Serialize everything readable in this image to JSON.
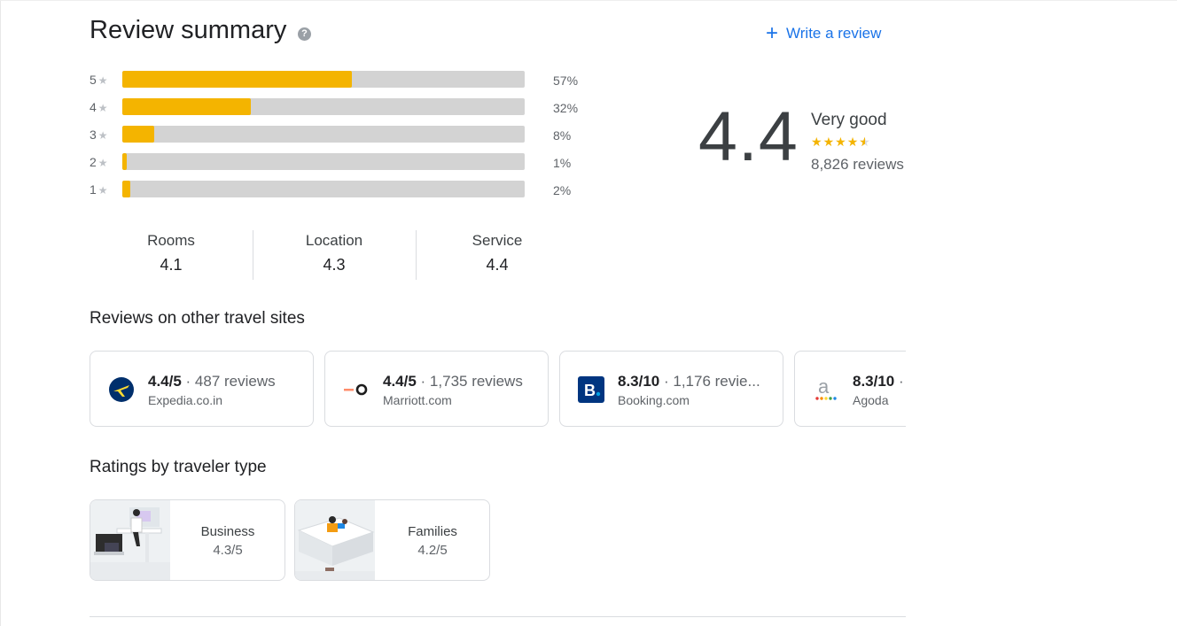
{
  "header": {
    "title": "Review summary",
    "help_icon": "help-circle-icon",
    "write_review_label": "Write a review",
    "write_review_icon": "plus-icon"
  },
  "distribution": [
    {
      "stars": "5",
      "percent_label": "57%",
      "fraction": 0.57
    },
    {
      "stars": "4",
      "percent_label": "32%",
      "fraction": 0.32
    },
    {
      "stars": "3",
      "percent_label": "8%",
      "fraction": 0.08
    },
    {
      "stars": "2",
      "percent_label": "1%",
      "fraction": 0.01
    },
    {
      "stars": "1",
      "percent_label": "2%",
      "fraction": 0.02
    }
  ],
  "overall": {
    "score": "4.4",
    "verdict": "Very good",
    "stars": 4.5,
    "review_count": "8,826 reviews"
  },
  "categories": [
    {
      "label": "Rooms",
      "value": "4.1"
    },
    {
      "label": "Location",
      "value": "4.3"
    },
    {
      "label": "Service",
      "value": "4.4"
    }
  ],
  "other_sites": {
    "heading": "Reviews on other travel sites",
    "items": [
      {
        "score": "4.4/5",
        "count": "· 487 reviews",
        "site": "Expedia.co.in",
        "logo": "expedia-logo-icon"
      },
      {
        "score": "4.4/5",
        "count": "· 1,735 reviews",
        "site": "Marriott.com",
        "logo": "marriott-logo-icon"
      },
      {
        "score": "8.3/10",
        "count": "· 1,176 revie...",
        "site": "Booking.com",
        "logo": "booking-logo-icon"
      },
      {
        "score": "8.3/10",
        "count": "·",
        "site": "Agoda",
        "logo": "agoda-logo-icon"
      }
    ]
  },
  "traveler_types": {
    "heading": "Ratings by traveler type",
    "items": [
      {
        "type": "Business",
        "score": "4.3/5"
      },
      {
        "type": "Families",
        "score": "4.2/5"
      }
    ]
  },
  "colors": {
    "accent": "#1a73e8",
    "star": "#f4b400",
    "bar_track": "#d3d3d3",
    "expedia": "#002f6c",
    "booking": "#003580",
    "marriott": "#ff8d6b"
  }
}
